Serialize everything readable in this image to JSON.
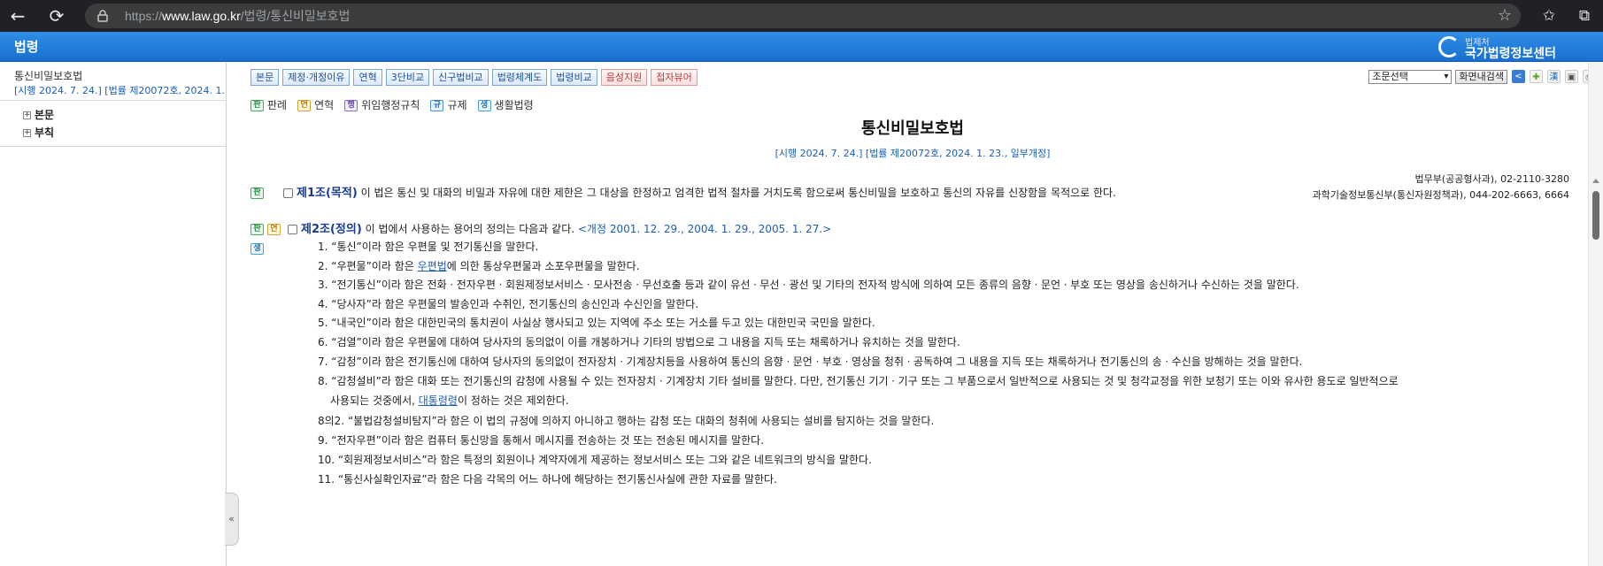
{
  "browser": {
    "url_prefix": "https://",
    "url_domain": "www.law.go.kr",
    "url_path": "/법령/통신비밀보호법"
  },
  "header": {
    "title": "법령",
    "logo_small": "법제처",
    "logo_big": "국가법령정보센터"
  },
  "sidebar": {
    "law_name": "통신비밀보호법",
    "law_date": "[시행 2024. 7. 24.] [법률 제20072호, 2024. 1. 23., 일부개정]",
    "tree": [
      {
        "label": "본문"
      },
      {
        "label": "부칙"
      }
    ]
  },
  "toolbar": {
    "buttons": [
      "본문",
      "제정·개정이유",
      "연혁",
      "3단비교",
      "신구법비교",
      "법령체계도",
      "법령비교",
      "음성지원",
      "접자뷰어"
    ],
    "select_value": "조문선택",
    "search_button": "화면내검색"
  },
  "legend": [
    {
      "tag": "판",
      "label": "판례"
    },
    {
      "tag": "연",
      "label": "연혁"
    },
    {
      "tag": "행",
      "label": "위임행정규칙"
    },
    {
      "tag": "규",
      "label": "규제"
    },
    {
      "tag": "생",
      "label": "생활법령"
    }
  ],
  "law": {
    "title": "통신비밀보호법",
    "date": "[시행 2024. 7. 24.] [법률 제20072호, 2024. 1. 23., 일부개정]",
    "ministry": [
      "법무부(공공형사과), 02-2110-3280",
      "과학기술정보통신부(통신자원정책과), 044-202-6663, 6664"
    ],
    "article1": {
      "tag": "판",
      "head": "제1조(목적)",
      "text": " 이 법은 통신 및 대화의 비밀과 자유에 대한 제한은 그 대상을 한정하고 엄격한 법적 절차를 거치도록 함으로써 통신비밀을 보호하고 통신의 자유를 신장함을 목적으로 한다."
    },
    "article2": {
      "tags": [
        "판",
        "연",
        "생"
      ],
      "head": "제2조(정의)",
      "text": " 이 법에서 사용하는 용어의 정의는 다음과 같다. ",
      "amend": "<개정 2001. 12. 29., 2004. 1. 29., 2005. 1. 27.>",
      "items": [
        {
          "text": "1. “통신”이라 함은 우편물 및 전기통신을 말한다."
        },
        {
          "pre": "2. “우편물”이라 함은 ",
          "link": "우편법",
          "post": "에 의한 통상우편물과 소포우편물을 말한다."
        },
        {
          "text": "3. “전기통신”이라 함은 전화ㆍ전자우편ㆍ회원제정보서비스ㆍ모사전송ㆍ무선호출 등과 같이 유선ㆍ무선ㆍ광선 및 기타의 전자적 방식에 의하여 모든 종류의 음향ㆍ문언ㆍ부호 또는 영상을 송신하거나 수신하는 것을 말한다."
        },
        {
          "text": "4. “당사자”라 함은 우편물의 발송인과 수취인, 전기통신의 송신인과 수신인을 말한다."
        },
        {
          "text": "5. “내국인”이라 함은 대한민국의 통치권이 사실상 행사되고 있는 지역에 주소 또는 거소를 두고 있는 대한민국 국민을 말한다."
        },
        {
          "text": "6. “검열”이라 함은 우편물에 대하여 당사자의 동의없이 이를 개봉하거나 기타의 방법으로 그 내용을 지득 또는 채록하거나 유치하는 것을 말한다."
        },
        {
          "text": "7. “감청”이라 함은 전기통신에 대하여 당사자의 동의없이 전자장치ㆍ기계장치등을 사용하여 통신의 음향ㆍ문언ㆍ부호ㆍ영상을 청취ㆍ공독하여 그 내용을 지득 또는 채록하거나 전기통신의 송ㆍ수신을 방해하는 것을 말한다."
        },
        {
          "text": "8. “감청설비”라 함은 대화 또는 전기통신의 감청에 사용될 수 있는 전자장치ㆍ기계장치 기타 설비를 말한다. 다만, 전기통신 기기ㆍ기구 또는 그 부품으로서 일반적으로 사용되는 것 및 청각교정을 위한 보청기 또는 이와 유사한 용도로 일반적으로"
        },
        {
          "pre": "사용되는 것중에서, ",
          "link": "대통령령",
          "post": "이 정하는 것은 제외한다.",
          "indent": true
        },
        {
          "text": "8의2. “불법감청설비탐지”라 함은 이 법의 규정에 의하지 아니하고 행하는 감청 또는 대화의 청취에 사용되는 설비를 탐지하는 것을 말한다."
        },
        {
          "text": "9. “전자우편”이라 함은 컴퓨터 통신망을 통해서 메시지를 전송하는 것 또는 전송된 메시지를 말한다."
        },
        {
          "text": "10. “회원제정보서비스”라 함은 특정의 회원이나 계약자에게 제공하는 정보서비스 또는 그와 같은 네트워크의 방식을 말한다."
        },
        {
          "text": "11. “통신사실확인자료”라 함은 다음 각목의 어느 하나에 해당하는 전기통신사실에 관한 자료를 말한다."
        }
      ]
    }
  }
}
